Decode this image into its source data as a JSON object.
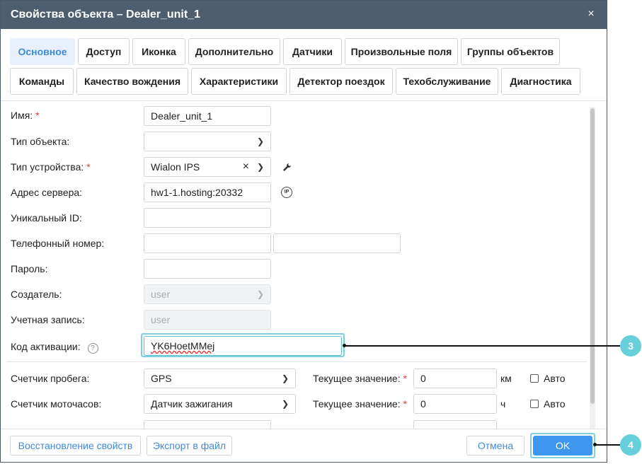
{
  "dialog": {
    "title": "Свойства объекта – Dealer_unit_1",
    "close_icon": "×"
  },
  "tabs": [
    {
      "label": "Основное"
    },
    {
      "label": "Доступ"
    },
    {
      "label": "Иконка"
    },
    {
      "label": "Дополнительно"
    },
    {
      "label": "Датчики"
    },
    {
      "label": "Произвольные поля"
    },
    {
      "label": "Группы объектов"
    },
    {
      "label": "Команды"
    },
    {
      "label": "Качество вождения"
    },
    {
      "label": "Характеристики"
    },
    {
      "label": "Детектор поездок"
    },
    {
      "label": "Техобслуживание"
    },
    {
      "label": "Диагностика"
    }
  ],
  "form": {
    "name": {
      "label": "Имя:",
      "value": "Dealer_unit_1"
    },
    "object_type": {
      "label": "Тип объекта:",
      "value": ""
    },
    "device_type": {
      "label": "Тип устройства:",
      "value": "Wialon IPS"
    },
    "server_address": {
      "label": "Адрес сервера:",
      "value": "hw1-1.hosting:20332",
      "ip_icon": "IP"
    },
    "unique_id": {
      "label": "Уникальный ID:",
      "value": ""
    },
    "phone": {
      "label": "Телефонный номер:",
      "value1": "",
      "value2": ""
    },
    "password": {
      "label": "Пароль:",
      "value": ""
    },
    "creator": {
      "label": "Создатель:",
      "value": "user"
    },
    "account": {
      "label": "Учетная запись:",
      "value": "user"
    },
    "activation_code": {
      "label": "Код активации:",
      "value": "YK6HoetMMej",
      "help_icon": "?"
    },
    "required_mark": "*"
  },
  "counters": {
    "mileage": {
      "label": "Счетчик пробега:",
      "value": "GPS",
      "current_label": "Текущее значение:",
      "current_value": "0",
      "unit": "км",
      "auto_label": "Авто"
    },
    "engine_hours": {
      "label": "Счетчик моточасов:",
      "value": "Датчик зажигания",
      "current_label": "Текущее значение:",
      "current_value": "0",
      "unit": "ч",
      "auto_label": "Авто"
    }
  },
  "footer": {
    "restore_label": "Восстановление свойств",
    "export_label": "Экспорт в файл",
    "cancel_label": "Отмена",
    "ok_label": "OK"
  },
  "callouts": {
    "c3": "3",
    "c4": "4"
  },
  "colors": {
    "accent": "#3f96ee",
    "titlebar": "#4f5e6f",
    "callout": "#66cfd9",
    "required": "#e03b3b"
  }
}
